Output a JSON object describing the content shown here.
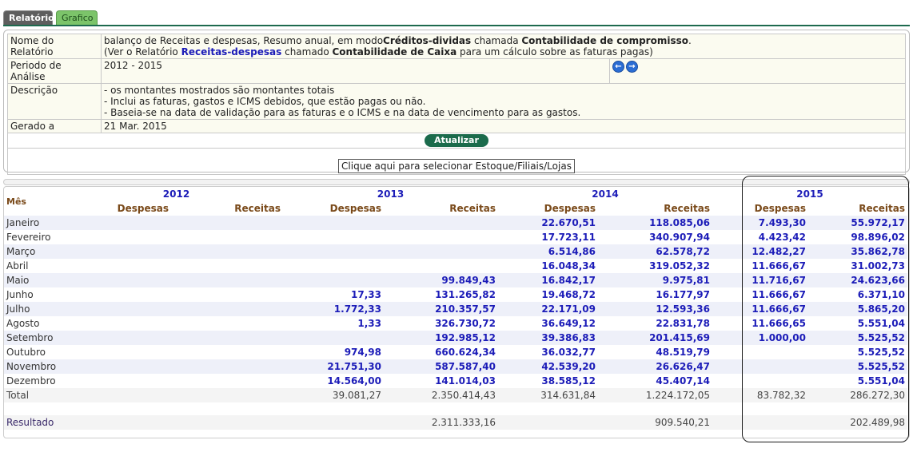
{
  "tabs": [
    "Relatório",
    "Grafico"
  ],
  "info": {
    "nome_label": "Nome do Relatório",
    "nome_line1_a": "balanço de Receitas e despesas, Resumo anual, em modo",
    "nome_line1_b": "Créditos-dividas",
    "nome_line1_c": " chamada ",
    "nome_line1_d": "Contabilidade de compromisso",
    "nome_line1_e": ".",
    "nome_line2_a": "(Ver o Relatório ",
    "nome_line2_b": "Receitas-despesas",
    "nome_line2_c": " chamado ",
    "nome_line2_d": "Contabilidade de Caixa",
    "nome_line2_e": " para um cálculo sobre as faturas pagas)",
    "periodo_label": "Periodo de Análise",
    "periodo_value": "2012 - 2015",
    "descricao_label": "Descrição",
    "descricao_lines": [
      "- os montantes mostrados são montantes totais",
      "- Inclui as faturas, gastos e ICMS debidos, que estão pagas ou não.",
      "- Baseia-se na data de validação para as faturas e o ICMS e na data de vencimento para as gastos."
    ],
    "gerado_label": "Gerado a",
    "gerado_value": "21 Mar. 2015",
    "update_button": "Atualizar",
    "select_button": "Clique aqui para selecionar Estoque/Filiais/Lojas"
  },
  "table": {
    "mes_header": "Mês",
    "years": [
      "2012",
      "2013",
      "2014",
      "2015"
    ],
    "despesas_label": "Despesas",
    "receitas_label": "Receitas",
    "rows": [
      {
        "month": "Janeiro",
        "v": [
          "",
          "",
          "",
          "",
          "22.670,51",
          "118.085,06",
          "7.493,30",
          "55.972,17"
        ]
      },
      {
        "month": "Fevereiro",
        "v": [
          "",
          "",
          "",
          "",
          "17.723,11",
          "340.907,94",
          "4.423,42",
          "98.896,02"
        ]
      },
      {
        "month": "Março",
        "v": [
          "",
          "",
          "",
          "",
          "6.514,86",
          "62.578,72",
          "12.482,27",
          "35.862,78"
        ]
      },
      {
        "month": "Abril",
        "v": [
          "",
          "",
          "",
          "",
          "16.048,34",
          "319.052,32",
          "11.666,67",
          "31.002,73"
        ]
      },
      {
        "month": "Maio",
        "v": [
          "",
          "",
          "",
          "99.849,43",
          "16.842,17",
          "9.975,81",
          "11.716,67",
          "24.623,66"
        ]
      },
      {
        "month": "Junho",
        "v": [
          "",
          "",
          "17,33",
          "131.265,82",
          "19.468,72",
          "16.177,97",
          "11.666,67",
          "6.371,10"
        ]
      },
      {
        "month": "Julho",
        "v": [
          "",
          "",
          "1.772,33",
          "210.357,57",
          "22.171,09",
          "12.593,36",
          "11.666,67",
          "5.865,20"
        ]
      },
      {
        "month": "Agosto",
        "v": [
          "",
          "",
          "1,33",
          "326.730,72",
          "36.649,12",
          "22.831,78",
          "11.666,65",
          "5.551,04"
        ]
      },
      {
        "month": "Setembro",
        "v": [
          "",
          "",
          "",
          "192.985,12",
          "39.386,83",
          "201.415,69",
          "1.000,00",
          "5.525,52"
        ]
      },
      {
        "month": "Outubro",
        "v": [
          "",
          "",
          "974,98",
          "660.624,34",
          "36.032,77",
          "48.519,79",
          "",
          "5.525,52"
        ]
      },
      {
        "month": "Novembro",
        "v": [
          "",
          "",
          "21.751,30",
          "587.587,40",
          "42.539,20",
          "26.626,47",
          "",
          "5.525,52"
        ]
      },
      {
        "month": "Dezembro",
        "v": [
          "",
          "",
          "14.564,00",
          "141.014,03",
          "38.585,12",
          "45.407,14",
          "",
          "5.551,04"
        ]
      }
    ],
    "total": {
      "label": "Total",
      "v": [
        "",
        "",
        "39.081,27",
        "2.350.414,43",
        "314.631,84",
        "1.224.172,05",
        "83.782,32",
        "286.272,30"
      ]
    },
    "result": {
      "label": "Resultado",
      "v": [
        "",
        "",
        "",
        "2.311.333,16",
        "",
        "909.540,21",
        "",
        "202.489,98"
      ]
    }
  },
  "colors": {
    "accent_blue": "#1c1cb8",
    "tab_active": "#5e5e5e",
    "tab_inactive": "#7cc46a",
    "update_button": "#1b6b4c",
    "row_stripe": "#eef0f9"
  }
}
